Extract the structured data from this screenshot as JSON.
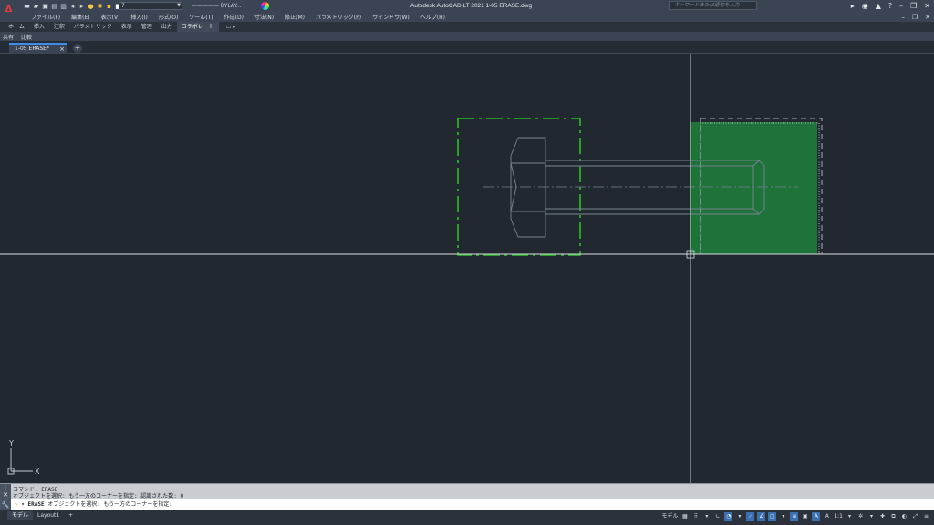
{
  "app": {
    "title": "Autodesk AutoCAD LT 2021    1-05 ERASE.dwg",
    "logo": "A"
  },
  "qat": {
    "layer_value": "7",
    "linetype_value": "————— BYLAY...",
    "icons": [
      "new-icon",
      "open-icon",
      "save-icon",
      "saveas-icon",
      "print-icon",
      "undo-icon",
      "redo-icon",
      "layer-on-icon",
      "sun-icon",
      "lock-icon",
      "color-square-icon"
    ]
  },
  "search": {
    "placeholder": "キーワードまたは語句を入力"
  },
  "menu": {
    "items": [
      "ファイル(F)",
      "編集(E)",
      "表示(V)",
      "挿入(I)",
      "形式(O)",
      "ツール(T)",
      "作成(D)",
      "寸法(N)",
      "修正(M)",
      "パラメトリック(P)",
      "ウィンドウ(W)",
      "ヘルプ(H)"
    ]
  },
  "ribbon": {
    "tabs": [
      "ホーム",
      "挿入",
      "注釈",
      "パラメトリック",
      "表示",
      "管理",
      "出力",
      "コラボレート"
    ],
    "active_index": 7,
    "extra": "▭ ▾"
  },
  "subribbon": {
    "items": [
      "共有",
      "比較"
    ]
  },
  "filetab": {
    "name": "1-05 ERASE*",
    "close": "×",
    "new": "+"
  },
  "ucs": {
    "x_label": "X",
    "y_label": "Y"
  },
  "command": {
    "history": [
      "コマンド: ERASE",
      "オブジェクトを選択: もう一方のコーナーを指定: 認識された数: 0"
    ],
    "prompt_cmd": "ERASE",
    "prompt_text": "オブジェクトを選択: もう一方のコーナーを指定:"
  },
  "status": {
    "layouts": [
      "モデル",
      "Layout1",
      "+"
    ],
    "active_layout": 0,
    "model_label": "モデル",
    "scale": "1:1"
  },
  "colors": {
    "canvas_bg": "#212830",
    "selection_green": "#1f7a3a",
    "crossing_outline": "#26c026",
    "crosshair": "#d9dde2"
  }
}
